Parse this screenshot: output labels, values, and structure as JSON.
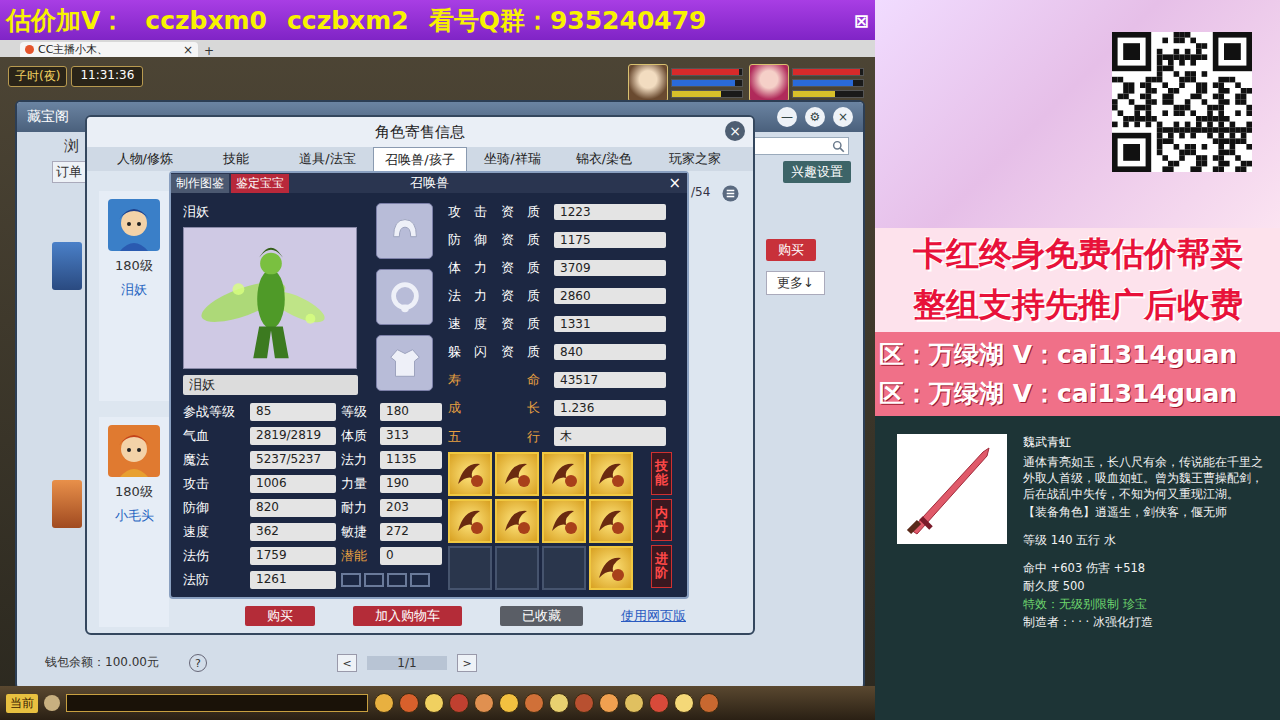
{
  "banner": {
    "texts": [
      "估价加V：",
      "cczbxm0",
      "cczbxm2",
      "看号Q群：935240479"
    ],
    "close_icon": "⊠"
  },
  "browser_tab": {
    "title": "CC主播小木、",
    "close_icon": "×",
    "new_tab_icon": "+"
  },
  "clock": {
    "period": "子时(夜)",
    "time": "11:31:36"
  },
  "party": [
    {
      "hp": 0.95,
      "mp": 0.9,
      "sp": 0.7
    },
    {
      "hp": 0.95,
      "mp": 0.85,
      "sp": 0.6
    }
  ],
  "market": {
    "title": "藏宝阁",
    "controls": [
      "—",
      "⚙",
      "×"
    ],
    "side_label": "浏",
    "sub_label": "订单",
    "interest_button": "兴趣设置",
    "buy_button": "购买",
    "more_button": "更多↓",
    "wallet": "钱包余额：100.00元",
    "help": "?",
    "pager": {
      "prev": "<",
      "page": "1/1",
      "next": ">"
    }
  },
  "dialog": {
    "title": "角色寄售信息",
    "close_icon": "×",
    "tabs": [
      {
        "label": "人物/修炼",
        "selected": false
      },
      {
        "label": "技能",
        "selected": false
      },
      {
        "label": "道具/法宝",
        "selected": false
      },
      {
        "label": "召唤兽/孩子",
        "selected": true
      },
      {
        "label": "坐骑/祥瑞",
        "selected": false
      },
      {
        "label": "锦衣/染色",
        "selected": false
      },
      {
        "label": "玩家之家",
        "selected": false
      }
    ],
    "pet_list": [
      {
        "level": "180级",
        "name": "泪妖"
      },
      {
        "level": "180级",
        "name": "小毛头"
      }
    ],
    "count": "/54",
    "buttons": [
      "购买",
      "加入购物车",
      "已收藏"
    ],
    "link": "使用网页版"
  },
  "pet": {
    "tabs": [
      {
        "label": "制作图鉴",
        "selected": false
      },
      {
        "label": "鉴定宝宝",
        "selected": true
      }
    ],
    "title": "召唤兽",
    "close_icon": "×",
    "name": "泪妖",
    "name_field": "泪妖",
    "stats": [
      {
        "label": "参战等级",
        "value": "85",
        "highlight": false
      },
      {
        "label": "等级",
        "value": "180",
        "highlight": false
      },
      {
        "label": "气血",
        "value": "2819/2819",
        "highlight": false
      },
      {
        "label": "体质",
        "value": "313",
        "highlight": false
      },
      {
        "label": "魔法",
        "value": "5237/5237",
        "highlight": false
      },
      {
        "label": "法力",
        "value": "1135",
        "highlight": false
      },
      {
        "label": "攻击",
        "value": "1006",
        "highlight": false
      },
      {
        "label": "力量",
        "value": "190",
        "highlight": false
      },
      {
        "label": "防御",
        "value": "820",
        "highlight": false
      },
      {
        "label": "耐力",
        "value": "203",
        "highlight": false
      },
      {
        "label": "速度",
        "value": "362",
        "highlight": false
      },
      {
        "label": "敏捷",
        "value": "272",
        "highlight": false
      },
      {
        "label": "法伤",
        "value": "1759",
        "highlight": false
      },
      {
        "label": "潜能",
        "value": "0",
        "highlight": true
      },
      {
        "label": "法防",
        "value": "1261",
        "highlight": false
      }
    ],
    "aptitudes": [
      {
        "label": "攻击资质",
        "value": "1223",
        "highlight": false
      },
      {
        "label": "防御资质",
        "value": "1175",
        "highlight": false
      },
      {
        "label": "体力资质",
        "value": "3709",
        "highlight": false
      },
      {
        "label": "法力资质",
        "value": "2860",
        "highlight": false
      },
      {
        "label": "速度资质",
        "value": "1331",
        "highlight": false
      },
      {
        "label": "躲闪资质",
        "value": "840",
        "highlight": false
      },
      {
        "label": "寿命",
        "value": "43517",
        "highlight": true
      },
      {
        "label": "成长",
        "value": "1.236",
        "highlight": true
      },
      {
        "label": "五行",
        "value": "木",
        "highlight": true
      }
    ],
    "skills": [
      {
        "filled": true
      },
      {
        "filled": true
      },
      {
        "filled": true
      },
      {
        "filled": true
      },
      {
        "filled": true
      },
      {
        "filled": true
      },
      {
        "filled": true
      },
      {
        "filled": true
      },
      {
        "filled": false
      },
      {
        "filled": false
      },
      {
        "filled": false
      },
      {
        "filled": true
      }
    ],
    "side_buttons": [
      "技能",
      "内丹",
      "进阶"
    ]
  },
  "taskbar": {
    "label": "当前"
  },
  "ads": [
    "卡红终身免费估价帮卖",
    "整组支持先推广后收费"
  ],
  "contacts": [
    "区：万绿湖 V：cai1314guan",
    "区：万绿湖 V：cai1314guan"
  ],
  "item": {
    "name": "魏武青虹",
    "description": "通体青亮如玉，长八尺有余，传说能在千里之外取人首级，吸血如虹。曾为魏王曹操配剑，后在战乱中失传，不知为何又重现江湖。",
    "roles": "【装备角色】逍遥生，剑侠客，偃无师",
    "level": "等级 140 五行 水",
    "stats": "命中 +603 伤害 +518",
    "durability": "耐久度 500",
    "effect": "特效：无级别限制 珍宝",
    "maker": "制造者：· · · 冰强化打造"
  }
}
